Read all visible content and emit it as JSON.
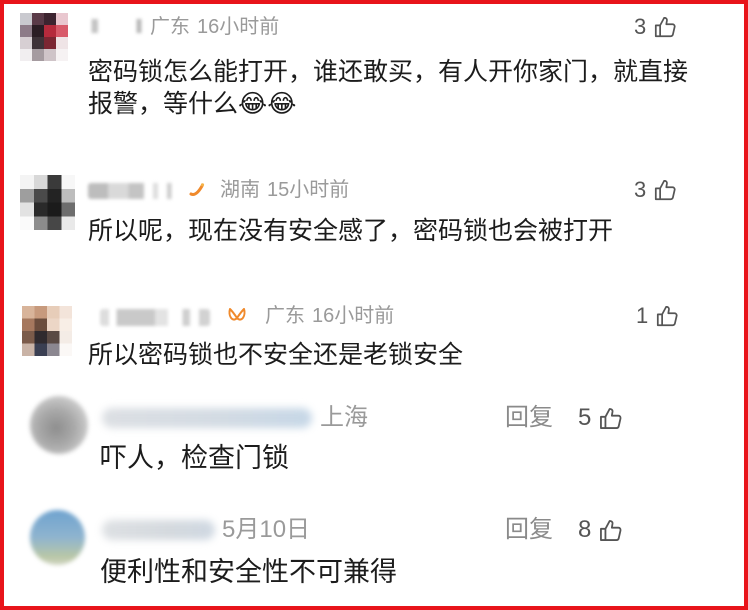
{
  "comments": [
    {
      "location": "广东",
      "time": "16小时前",
      "likes": "3",
      "text": "密码锁怎么能打开，谁还敢买，有人开你家门，就直接报警，等什么😂😂"
    },
    {
      "location": "湖南",
      "time": "15小时前",
      "likes": "3",
      "text": "所以呢，现在没有安全感了，密码锁也会被打开"
    },
    {
      "location": "广东",
      "time": "16小时前",
      "likes": "1",
      "text": "所以密码锁也不安全还是老锁安全"
    }
  ],
  "reply_comments": [
    {
      "meta": "上海",
      "reply_label": "回复",
      "likes": "5",
      "text": "吓人，检查门锁"
    },
    {
      "meta": "5月10日",
      "reply_label": "回复",
      "likes": "8",
      "text": "便利性和安全性不可兼得"
    }
  ],
  "icons": {
    "like": "thumbs-up-icon",
    "badge": "fan-badge-icon"
  },
  "colors": {
    "frame_border": "#e8141a",
    "text": "#1c1c1c",
    "meta": "#9a9a9a",
    "badge": "#f08a2c"
  }
}
